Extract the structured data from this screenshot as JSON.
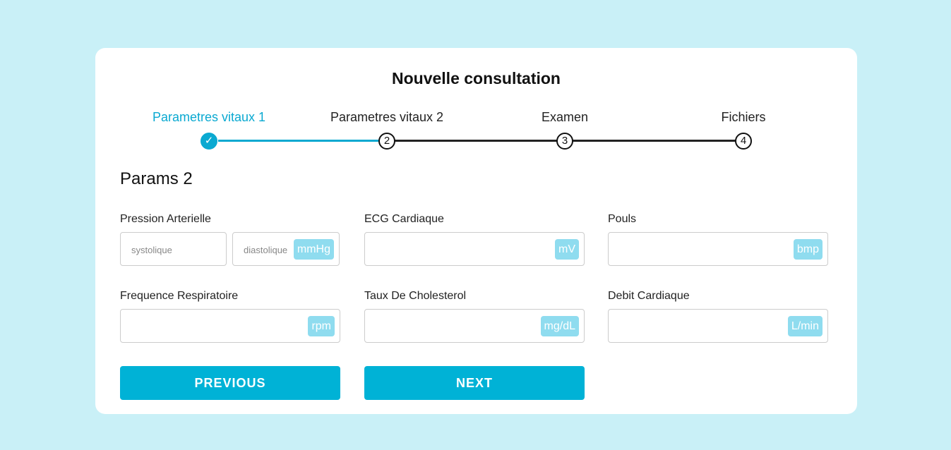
{
  "title": "Nouvelle consultation",
  "steps": [
    {
      "label": "Parametres vitaux 1",
      "number": "✓",
      "status": "done"
    },
    {
      "label": "Parametres vitaux 2",
      "number": "2",
      "status": "current"
    },
    {
      "label": "Examen",
      "number": "3",
      "status": "pending"
    },
    {
      "label": "Fichiers",
      "number": "4",
      "status": "pending"
    }
  ],
  "section_title": "Params 2",
  "fields": {
    "pression": {
      "label": "Pression Arterielle",
      "systolique_placeholder": "systolique",
      "diastolique_placeholder": "diastolique",
      "unit": "mmHg"
    },
    "ecg": {
      "label": "ECG Cardiaque",
      "value": "",
      "unit": "mV"
    },
    "pouls": {
      "label": "Pouls",
      "value": "",
      "unit": "bmp"
    },
    "frequence": {
      "label": "Frequence Respiratoire",
      "value": "",
      "unit": "rpm"
    },
    "cholesterol": {
      "label": "Taux De Cholesterol",
      "value": "",
      "unit": "mg/dL"
    },
    "debit": {
      "label": "Debit Cardiaque",
      "value": "",
      "unit": "L/min"
    }
  },
  "buttons": {
    "previous": "PREVIOUS",
    "next": "NEXT"
  },
  "colors": {
    "background": "#c9f0f7",
    "accent": "#00b2d6",
    "unit_badge": "#8fdcef",
    "active_step": "#0aa9d1"
  }
}
